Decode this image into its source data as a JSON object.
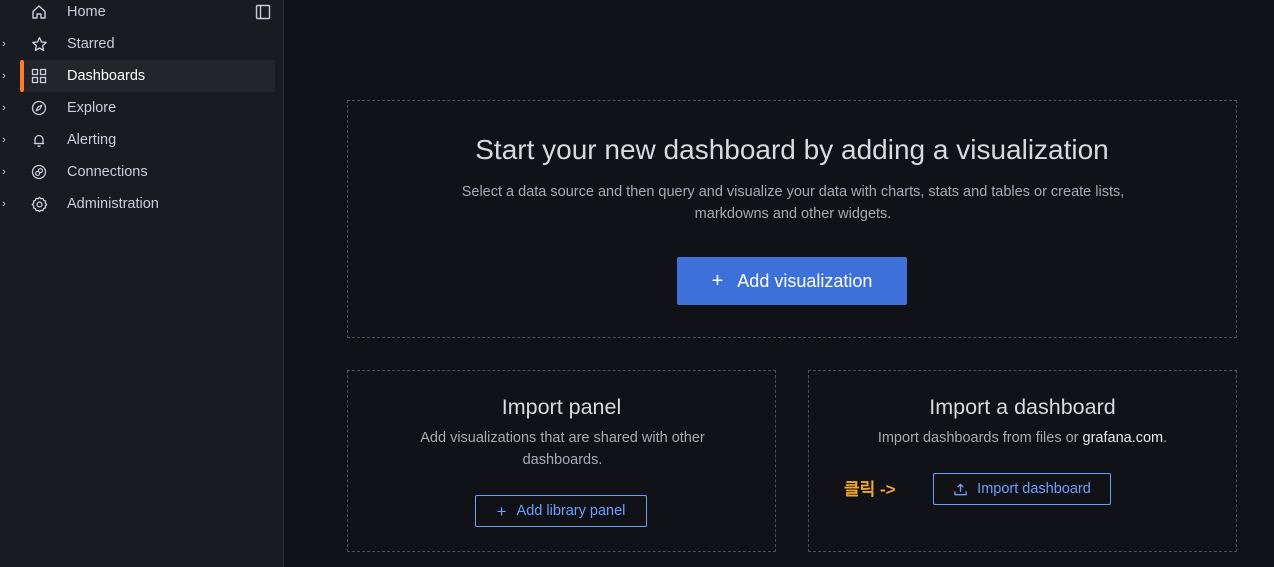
{
  "sidebar": {
    "items": [
      {
        "label": "Home",
        "icon": "home-icon",
        "expandable": false
      },
      {
        "label": "Starred",
        "icon": "star-icon",
        "expandable": true
      },
      {
        "label": "Dashboards",
        "icon": "apps-icon",
        "expandable": true,
        "active": true
      },
      {
        "label": "Explore",
        "icon": "compass-icon",
        "expandable": true
      },
      {
        "label": "Alerting",
        "icon": "bell-icon",
        "expandable": true
      },
      {
        "label": "Connections",
        "icon": "link-icon",
        "expandable": true
      },
      {
        "label": "Administration",
        "icon": "cog-icon",
        "expandable": true
      }
    ]
  },
  "main": {
    "title": "Start your new dashboard by adding a visualization",
    "description": "Select a data source and then query and visualize your data with charts, stats and tables or create lists, markdowns and other widgets.",
    "add_visualization_label": "Add visualization"
  },
  "import_panel": {
    "title": "Import panel",
    "description": "Add visualizations that are shared with other dashboards.",
    "button_label": "Add library panel"
  },
  "import_dashboard": {
    "title": "Import a dashboard",
    "description_prefix": "Import dashboards from files or ",
    "description_link": "grafana.com",
    "description_suffix": ".",
    "button_label": "Import dashboard",
    "annotation": "클릭 ->"
  },
  "colors": {
    "accent": "#ff7c2f",
    "primary": "#3d71d9",
    "link": "#6e9fff",
    "annotation": "#f5a623"
  }
}
